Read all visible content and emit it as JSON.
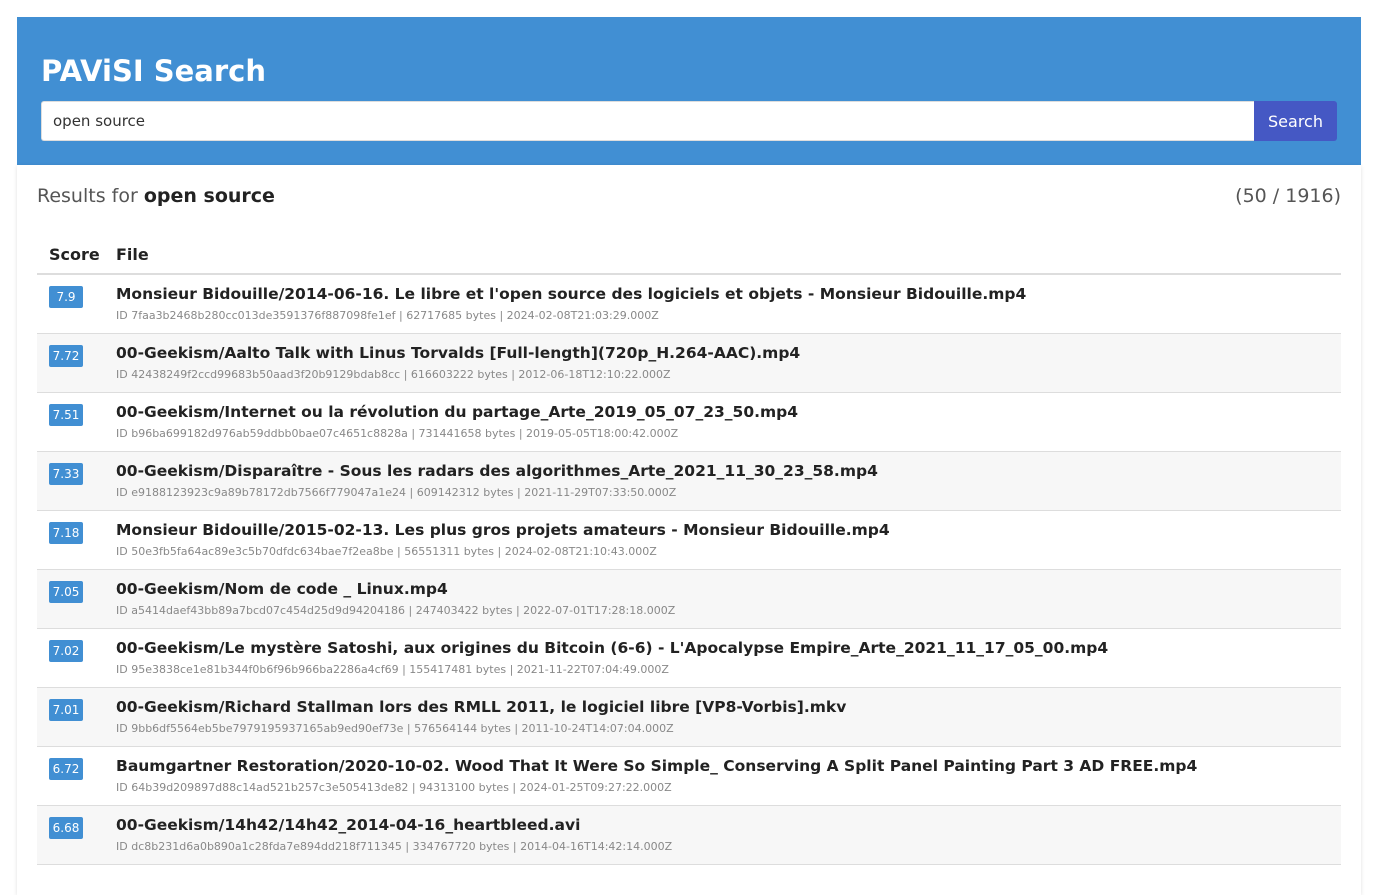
{
  "app": {
    "title": "PAViSI Search",
    "accent_color": "#418fd3",
    "button_color": "#4558c4"
  },
  "search": {
    "value": "open source",
    "button_label": "Search"
  },
  "results": {
    "heading_prefix": "Results for",
    "query": "open source",
    "count": "(50 / 1916)",
    "columns": [
      "Score",
      "File"
    ],
    "rows": [
      {
        "score": "7.9",
        "file": "Monsieur Bidouille/2014-06-16. Le libre et l'open source des logiciels et objets - Monsieur Bidouille.mp4",
        "meta": "ID 7faa3b2468b280cc013de3591376f887098fe1ef | 62717685 bytes | 2024-02-08T21:03:29.000Z"
      },
      {
        "score": "7.72",
        "file": "00-Geekism/Aalto Talk with Linus Torvalds [Full-length](720p_H.264-AAC).mp4",
        "meta": "ID 42438249f2ccd99683b50aad3f20b9129bdab8cc | 616603222 bytes | 2012-06-18T12:10:22.000Z"
      },
      {
        "score": "7.51",
        "file": "00-Geekism/Internet ou la révolution du partage_Arte_2019_05_07_23_50.mp4",
        "meta": "ID b96ba699182d976ab59ddbb0bae07c4651c8828a | 731441658 bytes | 2019-05-05T18:00:42.000Z"
      },
      {
        "score": "7.33",
        "file": "00-Geekism/Disparaître - Sous les radars des algorithmes_Arte_2021_11_30_23_58.mp4",
        "meta": "ID e9188123923c9a89b78172db7566f779047a1e24 | 609142312 bytes | 2021-11-29T07:33:50.000Z"
      },
      {
        "score": "7.18",
        "file": "Monsieur Bidouille/2015-02-13. Les plus gros projets amateurs - Monsieur Bidouille.mp4",
        "meta": "ID 50e3fb5fa64ac89e3c5b70dfdc634bae7f2ea8be | 56551311 bytes | 2024-02-08T21:10:43.000Z"
      },
      {
        "score": "7.05",
        "file": "00-Geekism/Nom de code _ Linux.mp4",
        "meta": "ID a5414daef43bb89a7bcd07c454d25d9d94204186 | 247403422 bytes | 2022-07-01T17:28:18.000Z"
      },
      {
        "score": "7.02",
        "file": "00-Geekism/Le mystère Satoshi, aux origines du Bitcoin (6-6) - L'Apocalypse Empire_Arte_2021_11_17_05_00.mp4",
        "meta": "ID 95e3838ce1e81b344f0b6f96b966ba2286a4cf69 | 155417481 bytes | 2021-11-22T07:04:49.000Z"
      },
      {
        "score": "7.01",
        "file": "00-Geekism/Richard Stallman lors des RMLL 2011, le logiciel libre [VP8-Vorbis].mkv",
        "meta": "ID 9bb6df5564eb5be7979195937165ab9ed90ef73e | 576564144 bytes | 2011-10-24T14:07:04.000Z"
      },
      {
        "score": "6.72",
        "file": "Baumgartner Restoration/2020-10-02. Wood That It Were So Simple_ Conserving A Split Panel Painting Part 3 AD FREE.mp4",
        "meta": "ID 64b39d209897d88c14ad521b257c3e505413de82 | 94313100 bytes | 2024-01-25T09:27:22.000Z"
      },
      {
        "score": "6.68",
        "file": "00-Geekism/14h42/14h42_2014-04-16_heartbleed.avi",
        "meta": "ID dc8b231d6a0b890a1c28fda7e894dd218f711345 | 334767720 bytes | 2014-04-16T14:42:14.000Z"
      }
    ]
  }
}
